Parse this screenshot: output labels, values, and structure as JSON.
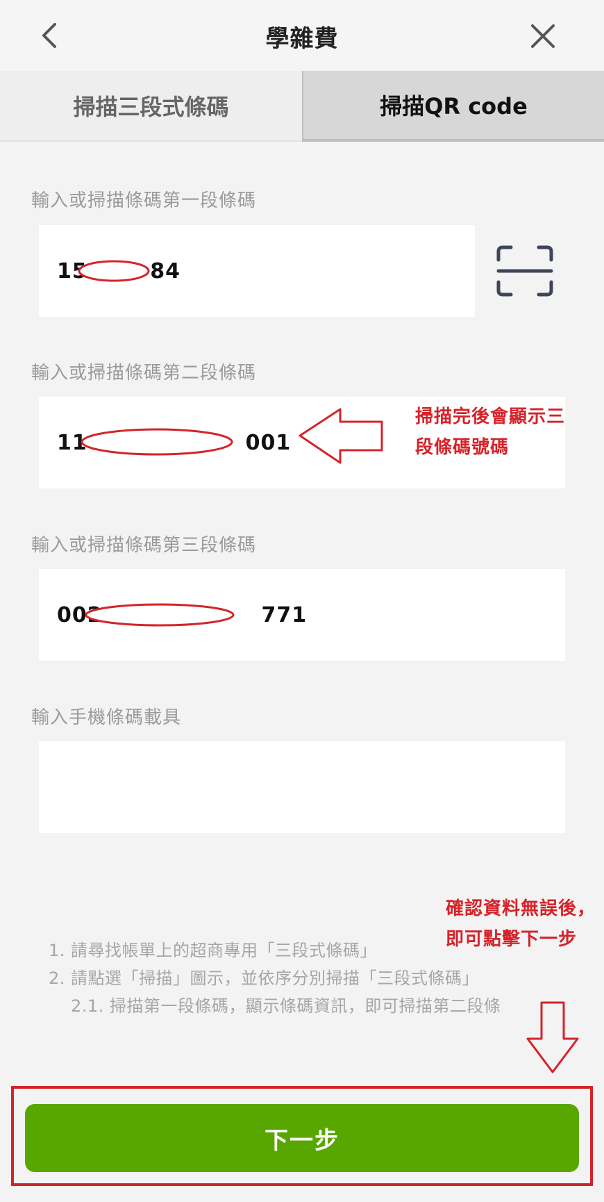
{
  "header": {
    "title": "學雜費"
  },
  "tabs": [
    {
      "label": "掃描三段式條碼"
    },
    {
      "label": "掃描QR code"
    }
  ],
  "fields": [
    {
      "label": "輸入或掃描條碼第一段條碼",
      "value": "156      84"
    },
    {
      "label": "輸入或掃描條碼第二段條碼",
      "value": "116                  001"
    },
    {
      "label": "輸入或掃描條碼第三段條碼",
      "value": "002                    771"
    },
    {
      "label": "輸入手機條碼載具",
      "value": ""
    }
  ],
  "annotations": {
    "arrow_note_line1": "掃描完後會顯示三",
    "arrow_note_line2": "段條碼號碼",
    "next_note_line1": "確認資料無誤後，",
    "next_note_line2": "即可點擊下一步"
  },
  "instructions": [
    "1. 請尋找帳單上的超商專用「三段式條碼」",
    "2. 請點選「掃描」圖示，並依序分別掃描「三段式條碼」",
    "2.1. 掃描第一段條碼，顯示條碼資訊，即可掃描第二段條"
  ],
  "footer": {
    "next_label": "下一步"
  },
  "colors": {
    "primary_green": "#58a700",
    "annotation_red": "#d6232a",
    "background": "#f3f3f3"
  },
  "icons": {
    "back": "chevron-left-icon",
    "close": "close-icon",
    "scan": "scan-frame-icon"
  }
}
